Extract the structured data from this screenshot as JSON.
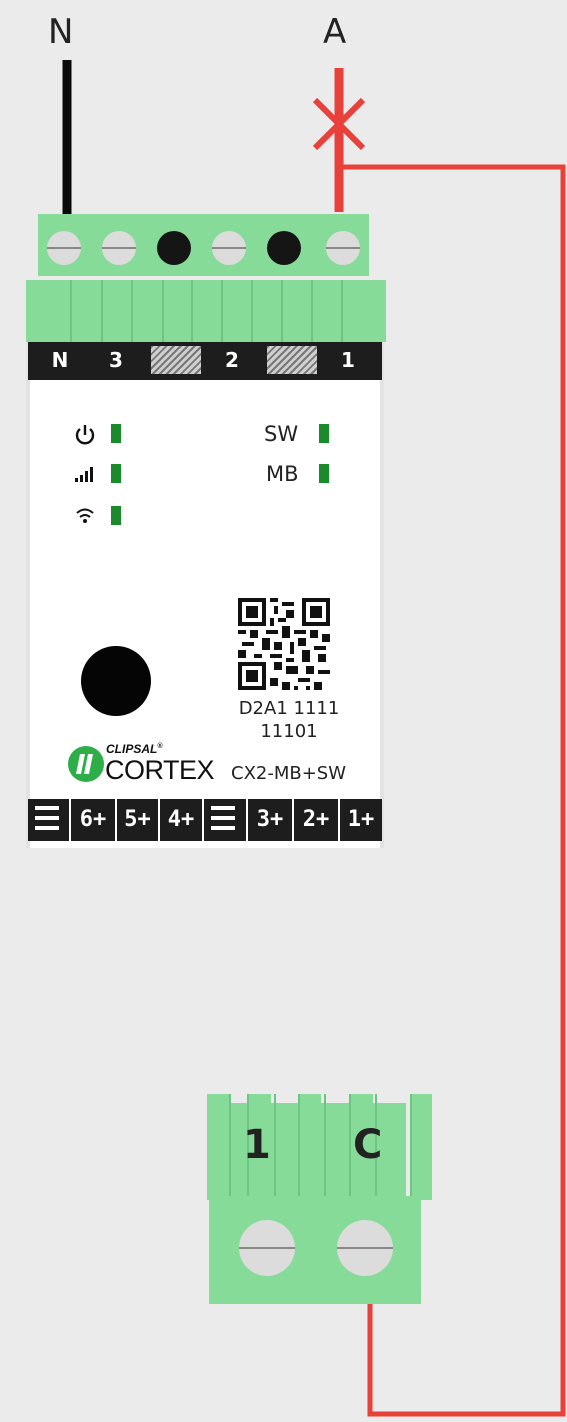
{
  "wires": {
    "neutral_label": "N",
    "active_label": "A",
    "neutral_color": "#0a0a0a",
    "active_color": "#e8403a"
  },
  "module": {
    "terminal_top": [
      "N",
      "3",
      "2",
      "1"
    ],
    "led_labels": [
      "SW",
      "MB"
    ],
    "led_icons": [
      "power-icon",
      "signal-bars-icon",
      "wifi-icon"
    ],
    "led_color": "#1a8a2a",
    "serial_line1": "D2A1  1111",
    "serial_line2": "11101",
    "brand_small": "CLIPSAL",
    "brand_reg": "®",
    "brand_big": "CORTEX",
    "model": "CX2-MB+SW",
    "terminal_bottom": [
      "6+",
      "5+",
      "4+",
      "3+",
      "2+",
      "1+"
    ],
    "body_color": "#86db98"
  },
  "switch_connector": {
    "label_left": "1",
    "label_right": "C"
  }
}
